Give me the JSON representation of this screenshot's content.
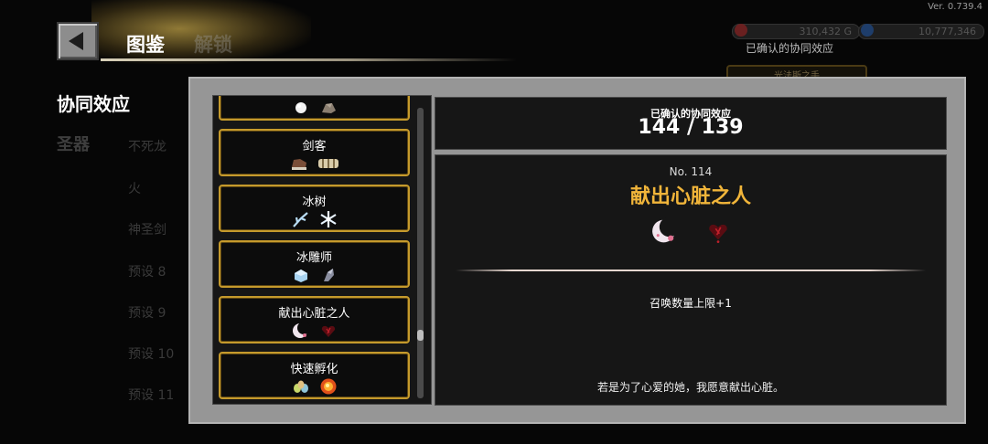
{
  "header": {
    "title": "图鉴",
    "inactive_tab": "解锁",
    "version": "Ver. 0.739.4",
    "currency_a": "310,432 G",
    "currency_b": "10,777,346",
    "confirmed_label": "已确认的协同效应",
    "bg_button": "光法斯之手"
  },
  "sidebar": {
    "active": "协同效应",
    "relic": "圣器",
    "rows": [
      "不死龙",
      "火",
      "神圣剑",
      "预设 8",
      "预设 9",
      "预设 10",
      "预设 11"
    ]
  },
  "list": {
    "cards": [
      {
        "name": "",
        "icons": [
          "pearl-icon",
          "rock-icon"
        ]
      },
      {
        "name": "剑客",
        "icons": [
          "glove-icon",
          "bandage-icon"
        ]
      },
      {
        "name": "冰树",
        "icons": [
          "ice-branch-icon",
          "snowflake-icon"
        ]
      },
      {
        "name": "冰雕师",
        "icons": [
          "ice-cube-icon",
          "chisel-icon"
        ]
      },
      {
        "name": "献出心脏之人",
        "icons": [
          "moon-icon",
          "heart-icon"
        ]
      },
      {
        "name": "快速孵化",
        "icons": [
          "eggs-icon",
          "fire-orb-icon"
        ]
      }
    ]
  },
  "count": {
    "label": "已确认的协同效应",
    "value": "144 / 139"
  },
  "detail": {
    "number": "No. 114",
    "name": "献出心脏之人",
    "icons": [
      "moon-icon",
      "heart-icon"
    ],
    "effect": "召唤数量上限+1",
    "quote": "若是为了心爱的她，我愿意献出心脏。"
  },
  "colors": {
    "card_border": "#c59a2c",
    "detail_title": "#f1b53a",
    "modal_frame": "#969696",
    "panel_bg": "#161616"
  }
}
